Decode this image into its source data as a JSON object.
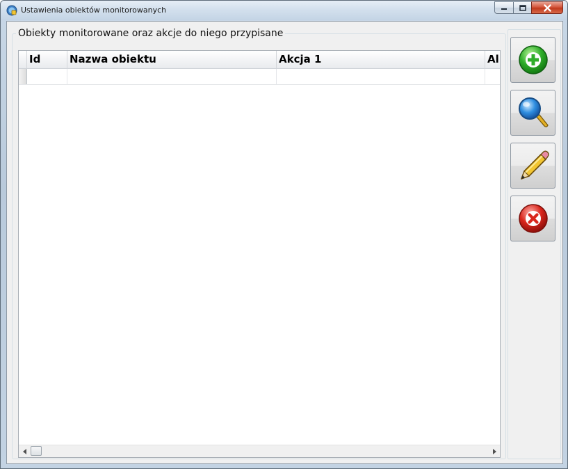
{
  "window": {
    "title": "Ustawienia obiektów monitorowanych"
  },
  "groupbox": {
    "title": "Obiekty monitorowane oraz akcje do niego przypisane"
  },
  "grid": {
    "columns": [
      "Id",
      "Nazwa obiektu",
      "Akcja 1",
      "Al"
    ],
    "rows": [
      [
        "",
        "",
        "",
        ""
      ]
    ]
  },
  "toolbar": {
    "buttons": [
      {
        "icon": "add-icon"
      },
      {
        "icon": "search-icon"
      },
      {
        "icon": "edit-icon"
      },
      {
        "icon": "delete-icon"
      }
    ]
  },
  "colors": {
    "add": "#2fae2a",
    "search": "#2e8ee0",
    "edit": "#f2c531",
    "delete": "#d9261c"
  }
}
